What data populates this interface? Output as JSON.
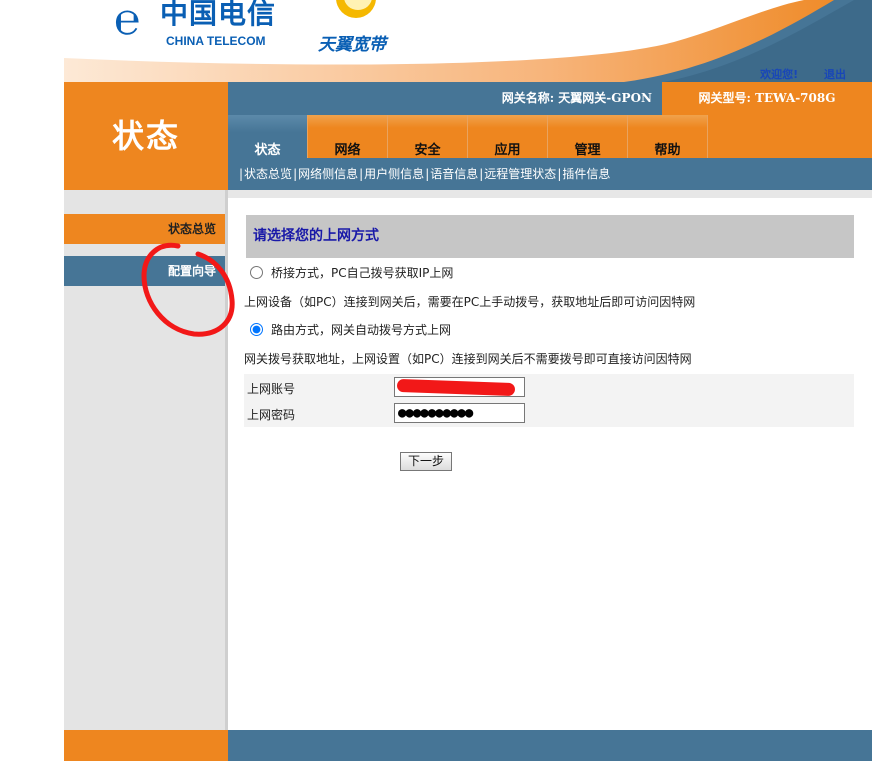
{
  "brand": {
    "logo_cn": "中国电信",
    "logo_en": "CHINA TELECOM",
    "logo_product": "天翼宽带"
  },
  "header": {
    "welcome": "欢迎您!",
    "logout": "退出",
    "section_title": "状态",
    "gateway_name": "网关名称:  天翼网关-GPON",
    "gateway_model": "网关型号:  TEWA-708G"
  },
  "tabs": [
    {
      "label": "状态",
      "active": true
    },
    {
      "label": "网络",
      "active": false
    },
    {
      "label": "安全",
      "active": false
    },
    {
      "label": "应用",
      "active": false
    },
    {
      "label": "管理",
      "active": false
    },
    {
      "label": "帮助",
      "active": false
    }
  ],
  "subnav": [
    "状态总览",
    "网络侧信息",
    "用户侧信息",
    "语音信息",
    "远程管理状态",
    "插件信息"
  ],
  "sidebar": {
    "items": [
      {
        "label": "状态总览"
      },
      {
        "label": "配置向导"
      }
    ]
  },
  "main": {
    "title": "请选择您的上网方式",
    "option_bridge": "桥接方式，PC自己拨号获取IP上网",
    "desc_bridge": "上网设备（如PC）连接到网关后，需要在PC上手动拨号，获取地址后即可访问因特网",
    "option_route": "路由方式，网关自动拨号方式上网",
    "desc_route": "网关拨号获取地址，上网设置（如PC）连接到网关后不需要拨号即可直接访问因特网",
    "selected_option": "route",
    "account_label": "上网账号",
    "password_label": "上网密码",
    "password_mask": "●●●●●●●●●●",
    "next_button": "下一步"
  },
  "colors": {
    "orange": "#ee861f",
    "steel_blue": "#467596",
    "annotation_red": "#f21818"
  }
}
